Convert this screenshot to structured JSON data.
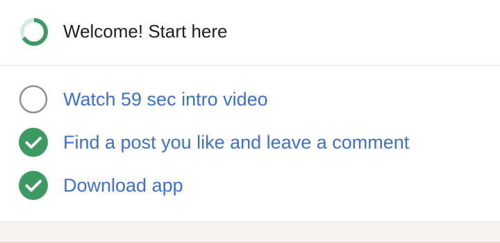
{
  "onboarding": {
    "title": "Welcome! Start here",
    "progress": {
      "completed": 2,
      "total": 3
    },
    "colors": {
      "accent_green": "#3e9a63",
      "ring_track": "#d6ebe0",
      "link_blue": "#3c6fd0",
      "pending_circle": "#8e8e8e"
    },
    "tasks": [
      {
        "label": "Watch 59 sec intro video",
        "completed": false,
        "icon": "empty-circle-icon"
      },
      {
        "label": "Find a post you like and leave a comment",
        "completed": true,
        "icon": "check-circle-icon"
      },
      {
        "label": "Download app",
        "completed": true,
        "icon": "check-circle-icon"
      }
    ]
  }
}
